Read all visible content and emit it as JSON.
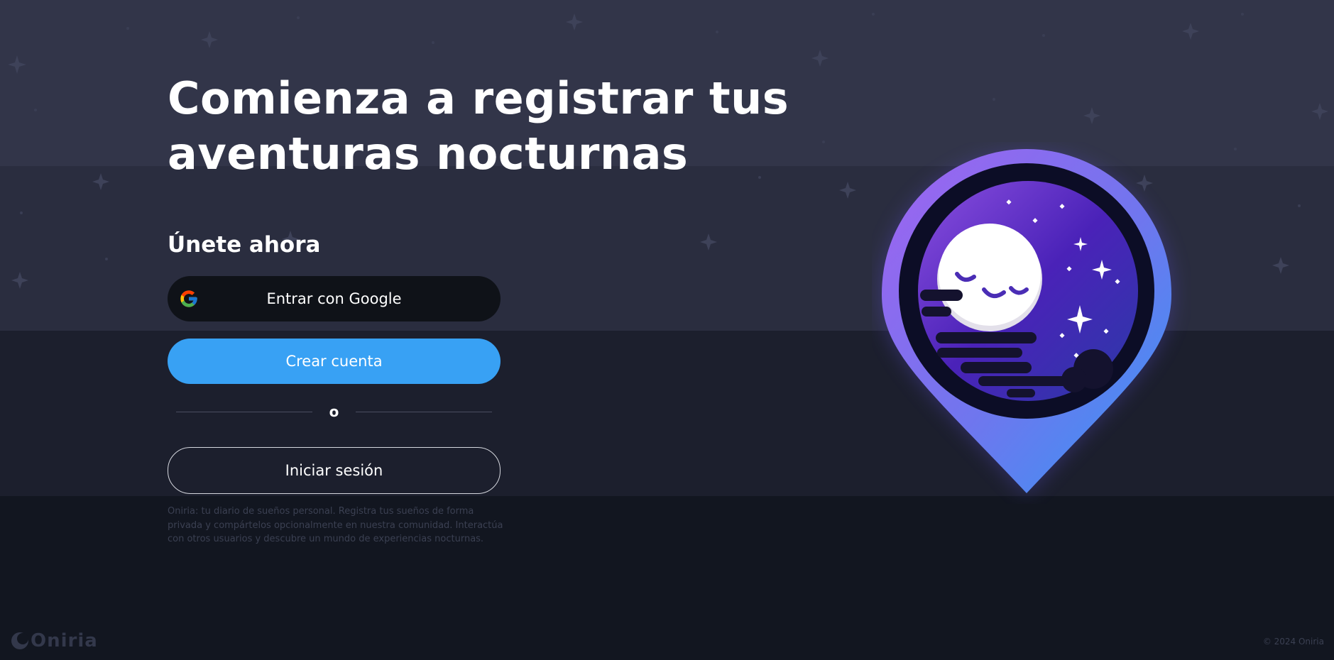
{
  "hero": {
    "title_line1": "Comienza a registrar tus",
    "title_line2": "aventuras nocturnas"
  },
  "signup": {
    "heading": "Únete ahora",
    "google_label": "Entrar con Google",
    "google_icon": "google-g-icon",
    "create_label": "Crear cuenta",
    "or_label": "o",
    "login_label": "Iniciar sesión"
  },
  "description": "Oniria: tu diario de sueños personal. Registra tus sueños de forma privada y compártelos opcionalmente en nuestra comunidad. Interactúa con otros usuarios y descubre un mundo de experiencias nocturnas.",
  "footer": {
    "brand": "Oniria",
    "copyright": "© 2024 Oniria"
  },
  "illustration": {
    "name": "sleeping-moon-map-pin",
    "icon": "moon-pin-icon"
  },
  "colors": {
    "band1": "#323549",
    "band2": "#2a2d3f",
    "band3": "#1c1f2d",
    "band4": "#121620",
    "primary_button": "#38a1f4",
    "google_button": "#0f1218",
    "pin_purple": "#a163f0",
    "pin_blue": "#3597f4"
  }
}
